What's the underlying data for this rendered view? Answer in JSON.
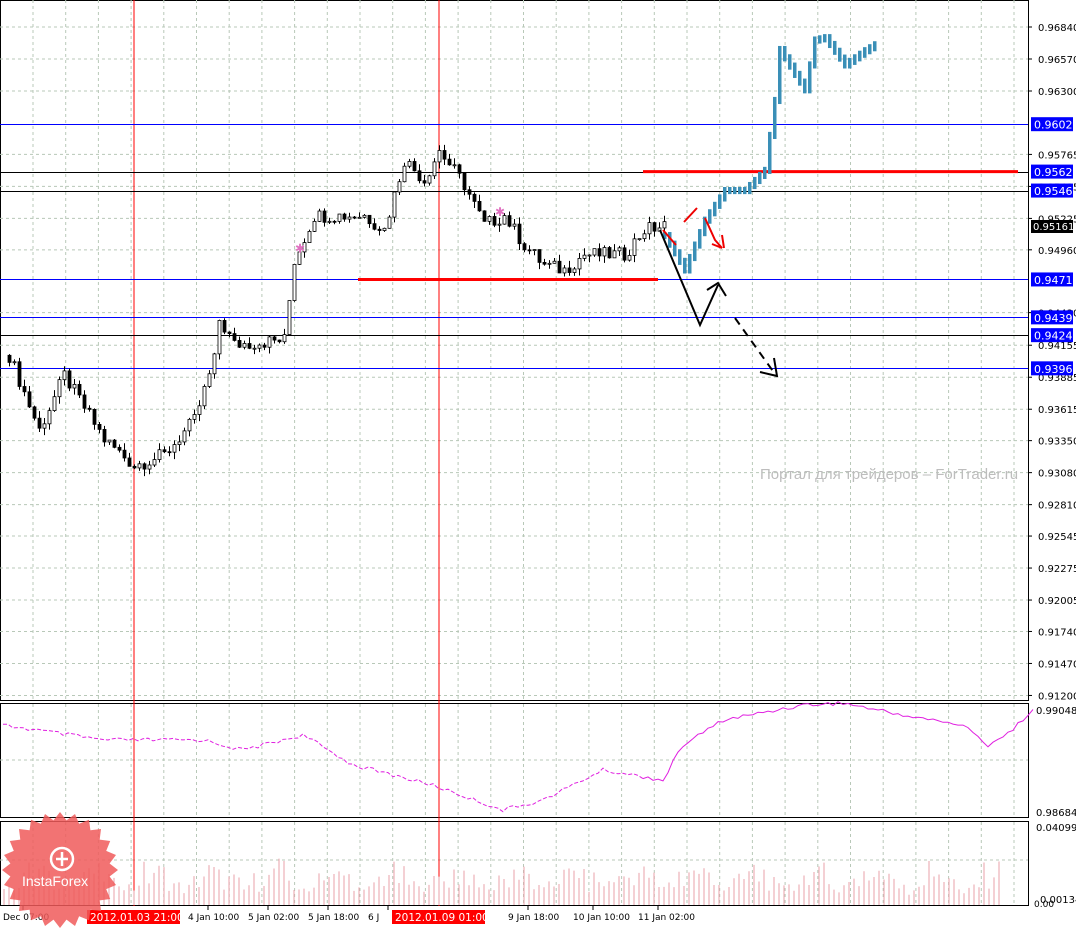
{
  "chart_data": {
    "type": "candlestick",
    "instrument_chart": "price chart with forecast",
    "price_axis": {
      "range": [
        0.912,
        0.9684
      ],
      "ticks": [
        "0.96840",
        "0.96570",
        "0.96300",
        "0.95765",
        "0.95495",
        "0.95225",
        "0.94960",
        "0.94430",
        "0.94155",
        "0.93885",
        "0.93615",
        "0.93350",
        "0.93080",
        "0.92810",
        "0.92545",
        "0.92275",
        "0.92005",
        "0.91740",
        "0.91470",
        "0.91200"
      ],
      "current_price": "0.95161"
    },
    "level_lines": [
      {
        "label": "0.9602",
        "value": 0.9602,
        "color": "#0000ff"
      },
      {
        "label": "0.9562",
        "value": 0.9562,
        "color": "#000000"
      },
      {
        "label": "0.9546",
        "value": 0.9546,
        "color": "#000000"
      },
      {
        "label": "0.9471",
        "value": 0.9471,
        "color": "#0000ff"
      },
      {
        "label": "0.9439",
        "value": 0.9439,
        "color": "#0000ff"
      },
      {
        "label": "0.9424",
        "value": 0.9424,
        "color": "#000000"
      },
      {
        "label": "0.9396",
        "value": 0.9396,
        "color": "#0000ff"
      }
    ],
    "red_segments": [
      {
        "value": 0.9562,
        "from_bar": 128,
        "to_bar": 203
      },
      {
        "value": 0.9471,
        "from_bar": 71,
        "to_bar": 131
      }
    ],
    "history_anchors": [
      [
        1,
        0.9407
      ],
      [
        7,
        0.9344
      ],
      [
        12,
        0.939
      ],
      [
        20,
        0.9336
      ],
      [
        26,
        0.9314
      ],
      [
        32,
        0.9323
      ],
      [
        38,
        0.9352
      ],
      [
        42,
        0.9403
      ],
      [
        43,
        0.9437
      ],
      [
        46,
        0.9416
      ],
      [
        56,
        0.942
      ],
      [
        58,
        0.9487
      ],
      [
        62,
        0.9525
      ],
      [
        72,
        0.9525
      ],
      [
        76,
        0.9513
      ],
      [
        80,
        0.9572
      ],
      [
        84,
        0.9555
      ],
      [
        87,
        0.958
      ],
      [
        92,
        0.9551
      ],
      [
        96,
        0.9517
      ],
      [
        100,
        0.9525
      ],
      [
        104,
        0.95
      ],
      [
        108,
        0.9483
      ],
      [
        112,
        0.9479
      ],
      [
        116,
        0.9492
      ],
      [
        124,
        0.9492
      ],
      [
        128,
        0.9513
      ],
      [
        132,
        0.9516
      ]
    ],
    "forecast_anchors": [
      [
        132,
        0.9508
      ],
      [
        136,
        0.9479
      ],
      [
        140,
        0.9521
      ],
      [
        144,
        0.9546
      ],
      [
        148,
        0.9546
      ],
      [
        152,
        0.9563
      ],
      [
        154,
        0.9622
      ],
      [
        155,
        0.9665
      ],
      [
        158,
        0.9644
      ],
      [
        160,
        0.9631
      ],
      [
        162,
        0.9673
      ],
      [
        164,
        0.9675
      ],
      [
        168,
        0.9652
      ],
      [
        172,
        0.9664
      ],
      [
        174,
        0.9669
      ]
    ],
    "time_labels": [
      {
        "label": "Dec 07:00",
        "bar": 4
      },
      {
        "label": "4 Jan 10:00",
        "bar": 41
      },
      {
        "label": "5 Jan 02:00",
        "bar": 53
      },
      {
        "label": "5 Jan 18:00",
        "bar": 65
      },
      {
        "label": "6 J",
        "bar": 77
      },
      {
        "label": "9 Jan 18:00",
        "bar": 105
      },
      {
        "label": "10 Jan 10:00",
        "bar": 118
      },
      {
        "label": "11 Jan 02:00",
        "bar": 131
      }
    ],
    "vertical_markers": [
      {
        "label": "2012.01.03 21:00",
        "bar": 26
      },
      {
        "label": "2012.01.09 01:00",
        "bar": 87
      }
    ],
    "indicator": {
      "range": [
        0.98684,
        0.99048
      ],
      "top_label": "0.99048",
      "bottom_label": "0.98684",
      "color": "#e020e0",
      "anchors": [
        [
          0,
          0.98994
        ],
        [
          20,
          0.98941
        ],
        [
          40,
          0.98941
        ],
        [
          48,
          0.98905
        ],
        [
          60,
          0.98959
        ],
        [
          70,
          0.98852
        ],
        [
          86,
          0.9878
        ],
        [
          100,
          0.98691
        ],
        [
          108,
          0.98727
        ],
        [
          120,
          0.98834
        ],
        [
          132,
          0.98798
        ],
        [
          136,
          0.98923
        ],
        [
          144,
          0.99012
        ],
        [
          160,
          0.99066
        ],
        [
          168,
          0.99073
        ],
        [
          180,
          0.9903
        ],
        [
          192,
          0.98994
        ],
        [
          197,
          0.98923
        ],
        [
          202,
          0.98977
        ],
        [
          206,
          0.99055
        ]
      ]
    },
    "volume": {
      "top_label": "0.04099",
      "bottom_label": "0.00134",
      "zero_label": "0.00",
      "color": "#e8a0a8"
    },
    "colors": {
      "candle": "#000000",
      "forecast": "#3a8fb7",
      "grid": "#b8c8b8",
      "marker": "#ff0000",
      "level_box": "#0000ff"
    }
  },
  "watermark": "Портал для трейдеров – ForTrader.ru",
  "logo": "InstaForex"
}
